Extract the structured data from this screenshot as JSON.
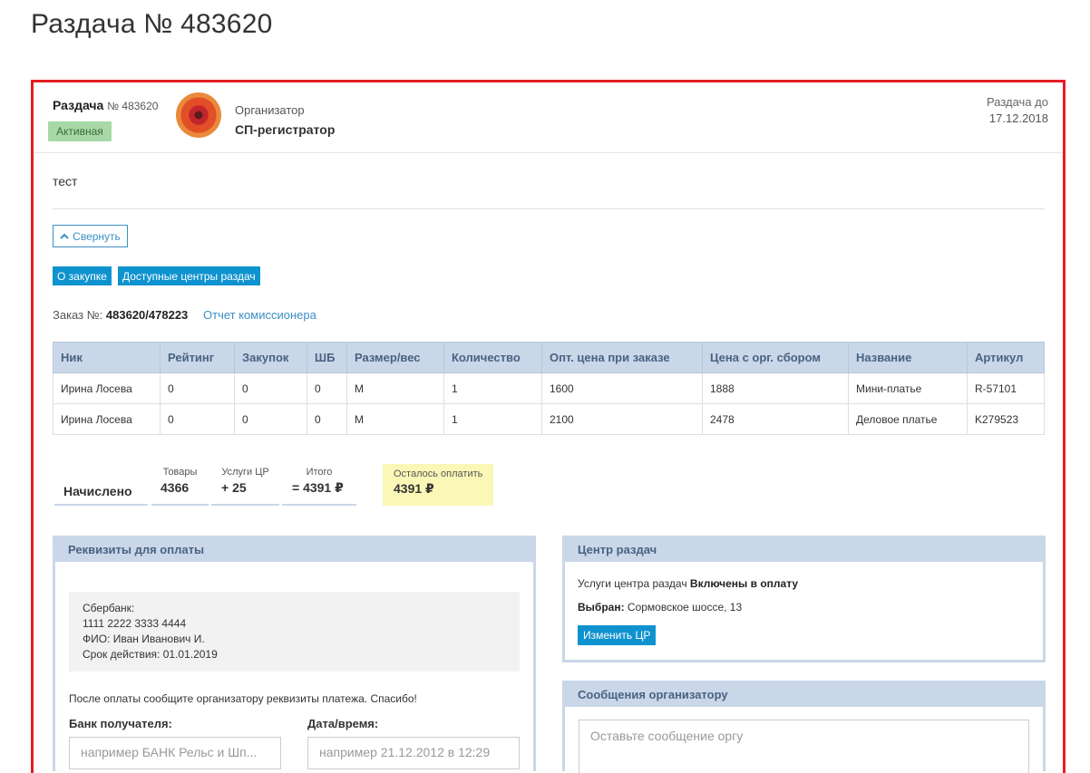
{
  "page": {
    "title": "Раздача № 483620"
  },
  "header": {
    "title_bold": "Раздача",
    "title_no": "№ 483620",
    "status": "Активная",
    "organizer_label": "Организатор",
    "organizer_name": "СП-регистратор",
    "until_label": "Раздача до",
    "until_date": "17.12.2018"
  },
  "description": "тест",
  "collapse_label": "Свернуть",
  "tabs": [
    {
      "label": "О закупке"
    },
    {
      "label": "Доступные центры раздач"
    }
  ],
  "order": {
    "label": "Заказ №:",
    "number": "483620/478223",
    "report_link": "Отчет комиссионера"
  },
  "table": {
    "columns": [
      "Ник",
      "Рейтинг",
      "Закупок",
      "ШБ",
      "Размер/вес",
      "Количество",
      "Опт. цена при заказе",
      "Цена с орг. сбором",
      "Название",
      "Артикул"
    ],
    "rows": [
      [
        "Ирина Лосева",
        "0",
        "0",
        "0",
        "M",
        "1",
        "1600",
        "1888",
        "Мини-платье",
        "R-57101"
      ],
      [
        "Ирина Лосева",
        "0",
        "0",
        "0",
        "M",
        "1",
        "2100",
        "2478",
        "Деловое платье",
        "K279523"
      ]
    ]
  },
  "summary": {
    "accrued_label": "Начислено",
    "goods_label": "Товары",
    "goods_value": "4366",
    "services_label": "Услуги ЦР",
    "services_value": "+ 25",
    "total_label": "Итого",
    "total_value": "= 4391 ₽",
    "due_label": "Осталось оплатить",
    "due_value": "4391 ₽"
  },
  "payment": {
    "header": "Реквизиты для оплаты",
    "bank": "Сбербанк:",
    "card": "1111 2222 3333 4444",
    "holder": "ФИО: Иван Иванович И.",
    "expiry": "Срок действия: 01.01.2019",
    "after_pay": "После оплаты сообщите организатору реквизиты платежа. Спасибо!",
    "bank_label": "Банк получателя:",
    "bank_placeholder": "например БАНК Рельс и Шп...",
    "datetime_label": "Дата/время:",
    "datetime_placeholder": "например 21.12.2012 в 12:29"
  },
  "center": {
    "header": "Центр раздач",
    "services_text": "Услуги центра раздач",
    "services_status": "Включены в оплату",
    "selected_label": "Выбран:",
    "selected_value": "Сормовское шоссе, 13",
    "change_button": "Изменить ЦР"
  },
  "messages": {
    "header": "Сообщения организатору",
    "placeholder": "Оставьте сообщение оргу"
  },
  "colors": {
    "frame": "#e31e24",
    "accent": "#0f93cf",
    "header_bg": "#c9d7e8",
    "status_bg": "#a7d8a5",
    "due_bg": "#fbf7b7"
  }
}
